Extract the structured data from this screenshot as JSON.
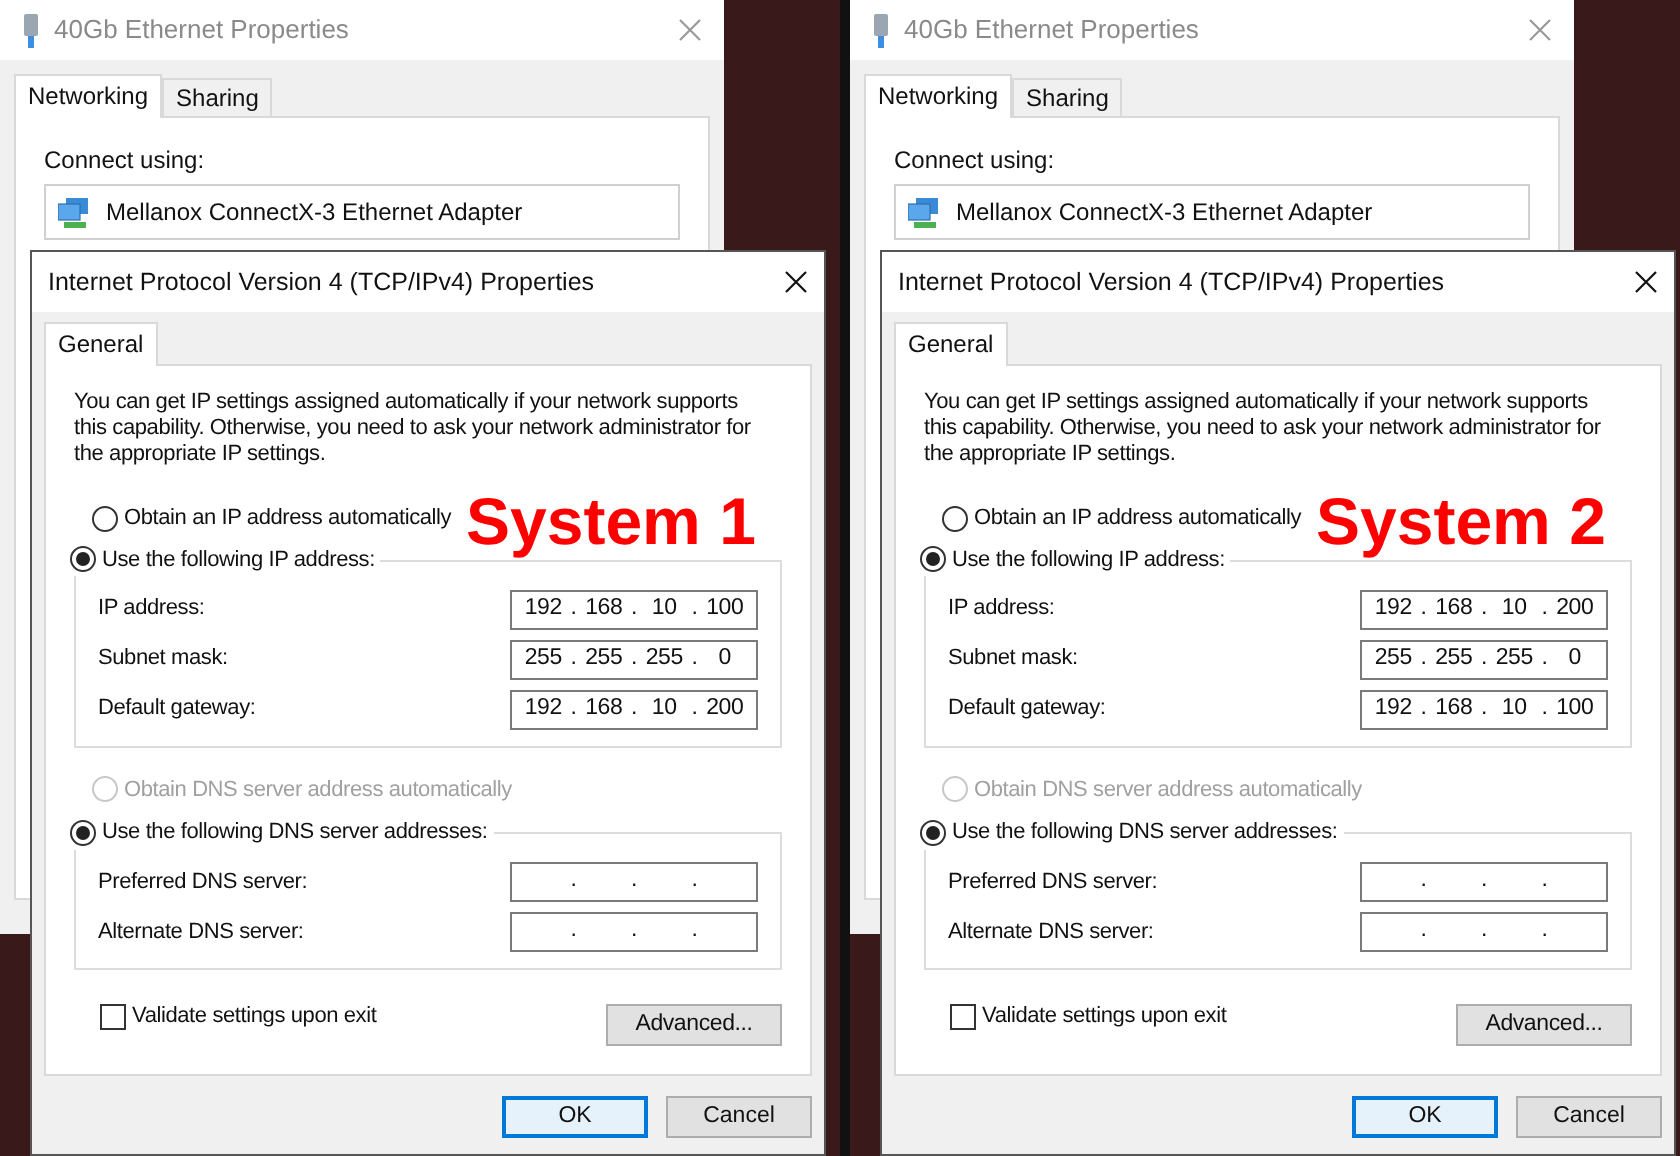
{
  "systems": [
    {
      "back_window": {
        "title": "40Gb Ethernet Properties",
        "tabs": [
          {
            "label": "Networking",
            "selected": true
          },
          {
            "label": "Sharing",
            "selected": false
          }
        ],
        "connect_label": "Connect using:",
        "adapter": "Mellanox ConnectX-3 Ethernet Adapter"
      },
      "dialog": {
        "title": "Internet Protocol Version 4 (TCP/IPv4) Properties",
        "tabs": [
          {
            "label": "General",
            "selected": true
          }
        ],
        "description": "You can get IP settings assigned automatically if your network supports this capability. Otherwise, you need to ask your network administrator for the appropriate IP settings.",
        "ip_auto": {
          "label": "Obtain an IP address automatically",
          "selected": false,
          "disabled": false
        },
        "ip_manual": {
          "label": "Use the following IP address:",
          "selected": true,
          "disabled": false
        },
        "ip_fields": [
          {
            "label": "IP address:",
            "separator": ".",
            "octets": [
              "192",
              "168",
              "10",
              "100"
            ]
          },
          {
            "label": "Subnet mask:",
            "separator": ".",
            "octets": [
              "255",
              "255",
              "255",
              "0"
            ]
          },
          {
            "label": "Default gateway:",
            "separator": ".",
            "octets": [
              "192",
              "168",
              "10",
              "200"
            ]
          }
        ],
        "dns_auto": {
          "label": "Obtain DNS server address automatically",
          "selected": false,
          "disabled": true
        },
        "dns_manual": {
          "label": "Use the following DNS server addresses:",
          "selected": true,
          "disabled": false
        },
        "dns_fields": [
          {
            "label": "Preferred DNS server:",
            "separator": "."
          },
          {
            "label": "Alternate DNS server:",
            "separator": "."
          }
        ],
        "validate": {
          "label": "Validate settings upon exit",
          "checked": false
        },
        "advanced_button": "Advanced...",
        "buttons": [
          {
            "label": "OK",
            "default": true
          },
          {
            "label": "Cancel",
            "default": false
          }
        ]
      },
      "overlay_label": "System 1"
    },
    {
      "back_window": {
        "title": "40Gb Ethernet Properties",
        "tabs": [
          {
            "label": "Networking",
            "selected": true
          },
          {
            "label": "Sharing",
            "selected": false
          }
        ],
        "connect_label": "Connect using:",
        "adapter": "Mellanox ConnectX-3 Ethernet Adapter"
      },
      "dialog": {
        "title": "Internet Protocol Version 4 (TCP/IPv4) Properties",
        "tabs": [
          {
            "label": "General",
            "selected": true
          }
        ],
        "description": "You can get IP settings assigned automatically if your network supports this capability. Otherwise, you need to ask your network administrator for the appropriate IP settings.",
        "ip_auto": {
          "label": "Obtain an IP address automatically",
          "selected": false,
          "disabled": false
        },
        "ip_manual": {
          "label": "Use the following IP address:",
          "selected": true,
          "disabled": false
        },
        "ip_fields": [
          {
            "label": "IP address:",
            "separator": ".",
            "octets": [
              "192",
              "168",
              "10",
              "200"
            ]
          },
          {
            "label": "Subnet mask:",
            "separator": ".",
            "octets": [
              "255",
              "255",
              "255",
              "0"
            ]
          },
          {
            "label": "Default gateway:",
            "separator": ".",
            "octets": [
              "192",
              "168",
              "10",
              "100"
            ]
          }
        ],
        "dns_auto": {
          "label": "Obtain DNS server address automatically",
          "selected": false,
          "disabled": true
        },
        "dns_manual": {
          "label": "Use the following DNS server addresses:",
          "selected": true,
          "disabled": false
        },
        "dns_fields": [
          {
            "label": "Preferred DNS server:",
            "separator": "."
          },
          {
            "label": "Alternate DNS server:",
            "separator": "."
          }
        ],
        "validate": {
          "label": "Validate settings upon exit",
          "checked": false
        },
        "advanced_button": "Advanced...",
        "buttons": [
          {
            "label": "OK",
            "default": true
          },
          {
            "label": "Cancel",
            "default": false
          }
        ]
      },
      "overlay_label": "System 2"
    }
  ]
}
